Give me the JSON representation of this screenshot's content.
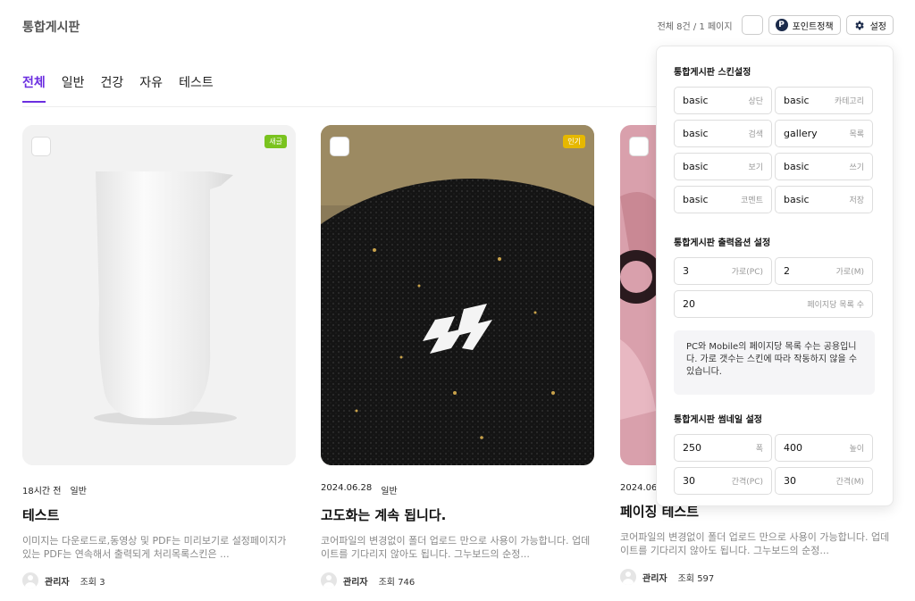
{
  "board": {
    "title": "통합게시판"
  },
  "topbar": {
    "count": "전체 8건 / 1 페이지",
    "point_label": "포인트정책",
    "settings_label": "설정",
    "point_icon": "P"
  },
  "tabs": [
    {
      "label": "전체",
      "active": true
    },
    {
      "label": "일반",
      "active": false
    },
    {
      "label": "건강",
      "active": false
    },
    {
      "label": "자유",
      "active": false
    },
    {
      "label": "테스트",
      "active": false
    }
  ],
  "cards": [
    {
      "badge": "새글",
      "badge_color": "#7ac31f",
      "meta_time": "18시간 전",
      "meta_cat": "일반",
      "title": "테스트",
      "desc": "이미지는 다운로드로,동영상 및 PDF는 미리보기로 설정페이지가 있는 PDF는 연속해서 출력되게 처리목록스킨은 ...",
      "author": "관리자",
      "views": "조회 3"
    },
    {
      "badge": "인기",
      "badge_color": "#e6b800",
      "meta_time": "2024.06.28",
      "meta_cat": "일반",
      "title": "고도화는 계속 됩니다.",
      "desc": "코어파일의 변경없이 폴더 업로드 만으로 사용이 가능합니다. 업데이트를 기다리지 않아도 됩니다. 그누보드의 순정...",
      "author": "관리자",
      "views": "조회 746"
    },
    {
      "badge": "",
      "badge_color": "",
      "meta_time": "2024.06",
      "meta_cat": "",
      "title": "페이징 테스트",
      "desc": "코어파일의 변경없이 폴더 업로드 만으로 사용이 가능합니다. 업데이트를 기다리지 않아도 됩니다. 그누보드의 순정...",
      "author": "관리자",
      "views": "조회 597"
    }
  ],
  "panel": {
    "skin_title": "통합게시판 스킨설정",
    "skin_fields": [
      {
        "value": "basic",
        "label": "상단"
      },
      {
        "value": "basic",
        "label": "카테고리"
      },
      {
        "value": "basic",
        "label": "검색"
      },
      {
        "value": "gallery",
        "label": "목록"
      },
      {
        "value": "basic",
        "label": "보기"
      },
      {
        "value": "basic",
        "label": "쓰기"
      },
      {
        "value": "basic",
        "label": "코멘트"
      },
      {
        "value": "basic",
        "label": "저장"
      }
    ],
    "output_title": "통합게시판 출력옵션 설정",
    "output_fields": [
      {
        "value": "3",
        "label": "가로(PC)"
      },
      {
        "value": "2",
        "label": "가로(M)"
      },
      {
        "value": "20",
        "label": "페이지당 목록 수"
      }
    ],
    "note": "PC와 Mobile의 페이지당 목록 수는 공용입니다. 가로 갯수는 스킨에 따라 작동하지 않을 수 있습니다.",
    "thumb_title": "통합게시판 썸네일 설정",
    "thumb_fields": [
      {
        "value": "250",
        "label": "폭"
      },
      {
        "value": "400",
        "label": "높이"
      },
      {
        "value": "30",
        "label": "간격(PC)"
      },
      {
        "value": "30",
        "label": "간격(M)"
      }
    ]
  }
}
